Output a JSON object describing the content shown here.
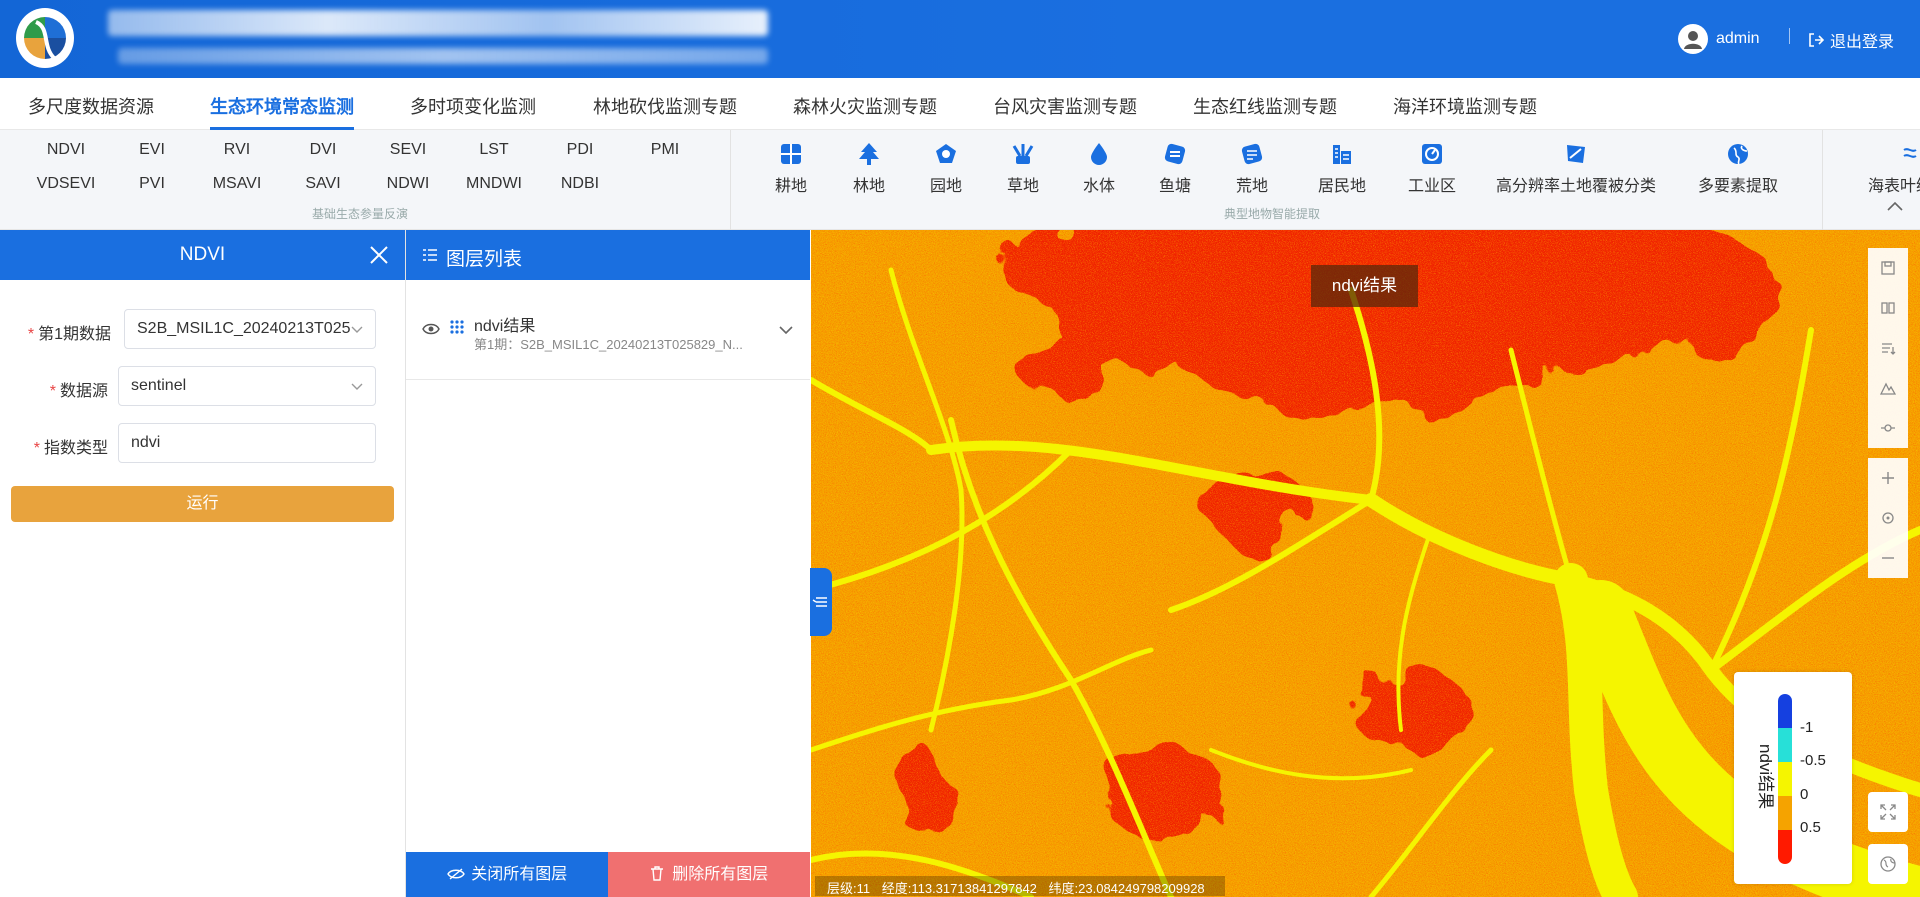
{
  "header": {
    "user_name": "admin",
    "logout_label": "退出登录"
  },
  "main_tabs": [
    {
      "label": "多尺度数据资源"
    },
    {
      "label": "生态环境常态监测",
      "active": true
    },
    {
      "label": "多时项变化监测"
    },
    {
      "label": "林地砍伐监测专题"
    },
    {
      "label": "森林火灾监测专题"
    },
    {
      "label": "台风灾害监测专题"
    },
    {
      "label": "生态红线监测专题"
    },
    {
      "label": "海洋环境监测专题"
    }
  ],
  "indices": {
    "row1": [
      "NDVI",
      "EVI",
      "RVI",
      "DVI",
      "SEVI",
      "LST",
      "PDI",
      "PMI"
    ],
    "row2": [
      "VDSEVI",
      "PVI",
      "MSAVI",
      "SAVI",
      "NDWI",
      "MNDWI",
      "NDBI"
    ],
    "caption": "基础生态参量反演"
  },
  "features": {
    "items": [
      {
        "label": "耕地",
        "icon": "farmland-icon"
      },
      {
        "label": "林地",
        "icon": "forest-icon"
      },
      {
        "label": "园地",
        "icon": "garden-icon"
      },
      {
        "label": "草地",
        "icon": "grass-icon"
      },
      {
        "label": "水体",
        "icon": "water-icon"
      },
      {
        "label": "鱼塘",
        "icon": "fishpond-icon"
      },
      {
        "label": "荒地",
        "icon": "wasteland-icon"
      },
      {
        "label": "居民地",
        "icon": "residential-icon"
      },
      {
        "label": "工业区",
        "icon": "industrial-icon"
      },
      {
        "label": "高分辨率土地覆被分类",
        "icon": "land-cover-icon"
      },
      {
        "label": "多要素提取",
        "icon": "globe-icon"
      },
      {
        "label": "海表叶绿",
        "icon": "sea-surface-icon"
      }
    ],
    "caption": "典型地物智能提取"
  },
  "left_panel": {
    "title": "NDVI",
    "fields": [
      {
        "label": "第1期数据",
        "value": "S2B_MSIL1C_20240213T025"
      },
      {
        "label": "数据源",
        "value": "sentinel"
      },
      {
        "label": "指数类型",
        "value": "ndvi"
      }
    ],
    "run_label": "运行"
  },
  "layer_panel": {
    "title": "图层列表",
    "layers": [
      {
        "name": "ndvi结果",
        "subtitle": "第1期：S2B_MSIL1C_20240213T025829_N..."
      }
    ],
    "close_all_label": "关闭所有图层",
    "delete_all_label": "删除所有图层"
  },
  "map": {
    "overlay_label": "ndvi结果",
    "legend": {
      "title": "ndvi结果",
      "ticks": [
        "-1",
        "-0.5",
        "0",
        "0.5"
      ],
      "colors": [
        "#1540e0",
        "#27e0d8",
        "#f5f500",
        "#f5a300",
        "#ff1a00"
      ]
    },
    "status": {
      "level": "层级:11",
      "longitude": "经度:113.31713841297842",
      "latitude": "纬度:23.084249798209928"
    }
  },
  "colors": {
    "primary": "#1a6fe0",
    "run_button": "#e8a33d",
    "delete_button": "#f07070"
  }
}
